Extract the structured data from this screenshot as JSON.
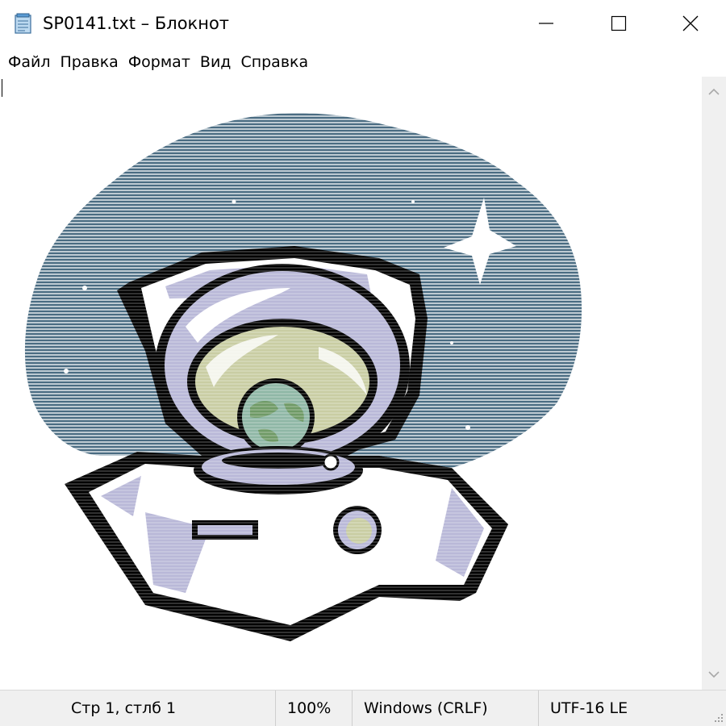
{
  "window": {
    "title": "SP0141.txt – Блокнот",
    "icons": {
      "app": "notepad-icon",
      "minimize": "minimize-icon",
      "maximize": "maximize-icon",
      "close": "close-icon"
    }
  },
  "menu": {
    "items": [
      {
        "label": "Файл"
      },
      {
        "label": "Правка"
      },
      {
        "label": "Формат"
      },
      {
        "label": "Вид"
      },
      {
        "label": "Справка"
      }
    ]
  },
  "document": {
    "content_type": "ascii-art-astronaut",
    "colors": {
      "space": "#4a6c82",
      "suit": "#b9b8d8",
      "visor": "#c9cda3",
      "earth": "#8fb7a6",
      "land": "#6f9a66",
      "outline": "#000000"
    }
  },
  "scrollbar": {
    "up_icon": "chevron-up-icon",
    "down_icon": "chevron-down-icon"
  },
  "status": {
    "position": "Стр 1, стлб 1",
    "zoom": "100%",
    "line_endings": "Windows (CRLF)",
    "encoding": "UTF-16 LE",
    "grip_icon": "resize-grip-icon"
  }
}
